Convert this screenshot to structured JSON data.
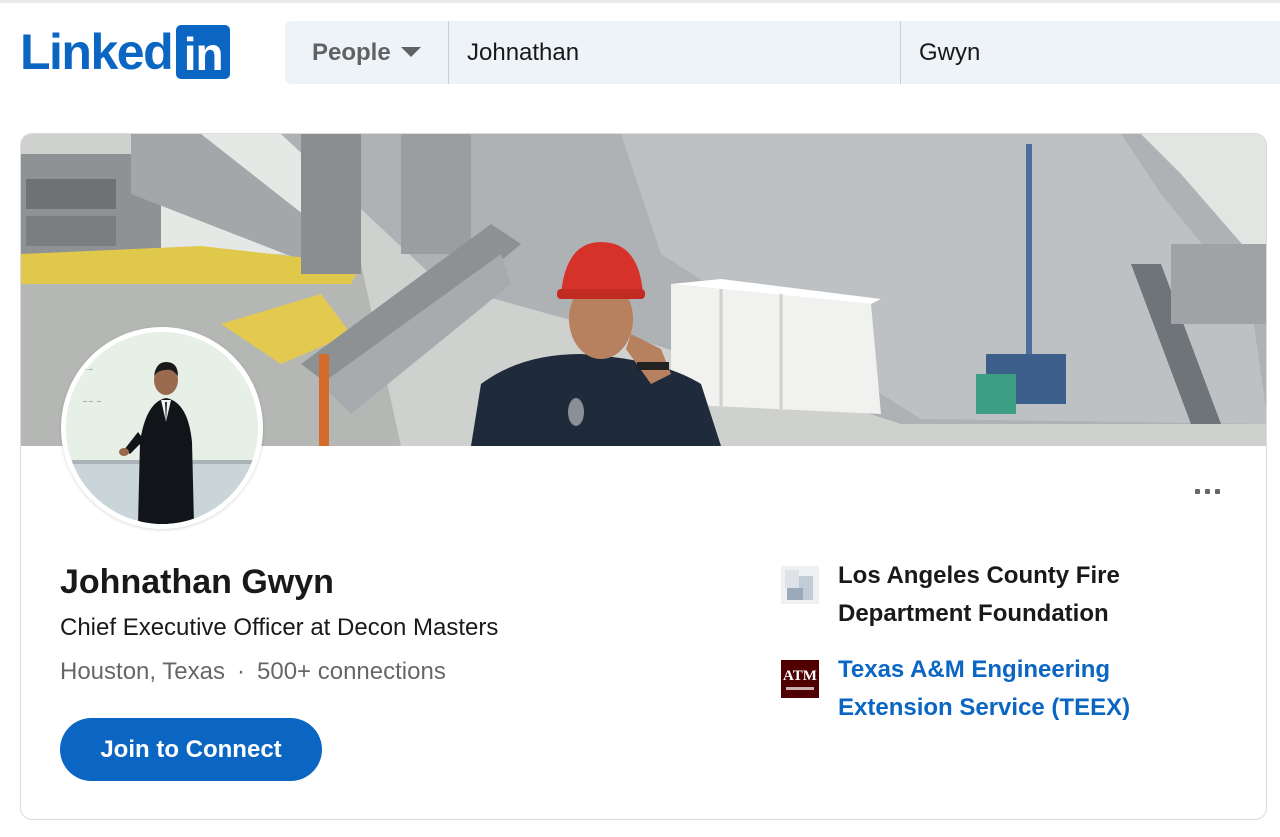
{
  "brand": {
    "name": "Linked",
    "box": "in",
    "color": "#0a66c2"
  },
  "search": {
    "category": "People",
    "first_name": "Johnathan",
    "last_name": "Gwyn"
  },
  "profile": {
    "name": "Johnathan Gwyn",
    "headline": "Chief Executive Officer at Decon Masters",
    "location": "Houston, Texas",
    "separator": "·",
    "connections": "500+ connections",
    "join_label": "Join to Connect",
    "more_icon": "ellipsis-icon"
  },
  "organizations": [
    {
      "name": "Los Angeles County Fire Department Foundation",
      "icon": "building-placeholder-icon",
      "link": false
    },
    {
      "name": "Texas A&M Engineering Extension Service (TEEX)",
      "icon": "tamu-logo",
      "link": true
    }
  ],
  "tamu_logo_letters": "ATM",
  "colors": {
    "accent": "#0a66c2",
    "tamu": "#500000"
  }
}
